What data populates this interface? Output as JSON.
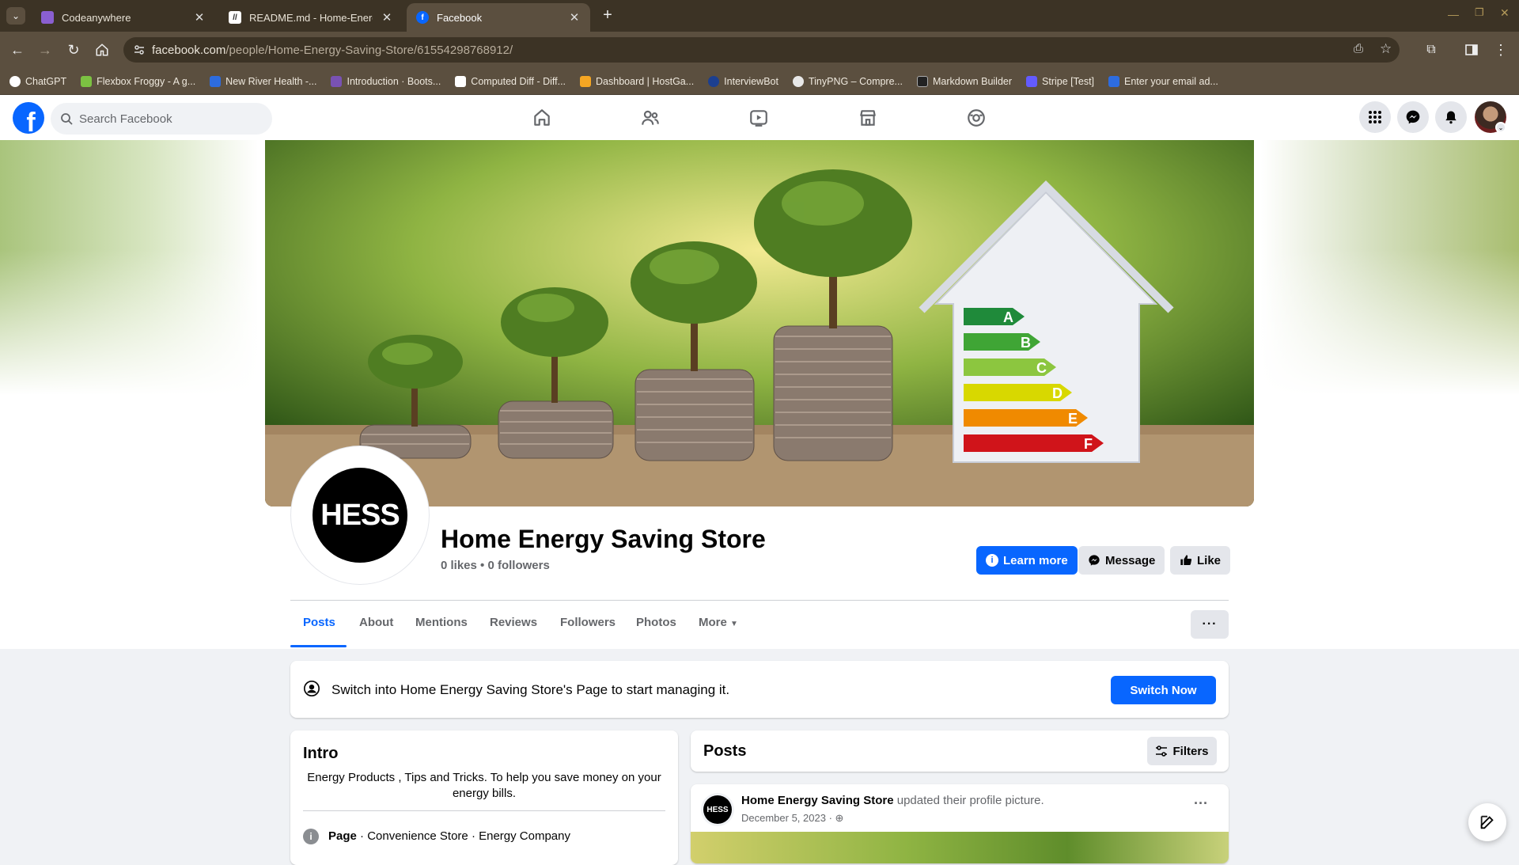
{
  "browser": {
    "tabs": [
      {
        "title": "Codeanywhere",
        "favicon": "codeanywhere-icon",
        "active": false
      },
      {
        "title": "README.md - Home-Energy-Sa",
        "favicon": "readme-icon",
        "active": false
      },
      {
        "title": "Facebook",
        "favicon": "facebook-icon",
        "active": true
      }
    ],
    "new_tab": "+",
    "url_host": "facebook.com",
    "url_path": "/people/Home-Energy-Saving-Store/61554298768912/",
    "bookmarks": [
      {
        "label": "ChatGPT",
        "color": "#ffffff"
      },
      {
        "label": "Flexbox Froggy - A g...",
        "color": "#7cc242"
      },
      {
        "label": "New River Health -...",
        "color": "#2d6cdf"
      },
      {
        "label": "Introduction · Boots...",
        "color": "#7952b3"
      },
      {
        "label": "Computed Diff - Diff...",
        "color": "#ffffff"
      },
      {
        "label": "Dashboard | HostGa...",
        "color": "#f5a623"
      },
      {
        "label": "InterviewBot",
        "color": "#1c3f8f"
      },
      {
        "label": "TinyPNG – Compre...",
        "color": "#e8e8e8"
      },
      {
        "label": "Markdown Builder",
        "color": "#222222"
      },
      {
        "label": "Stripe [Test]",
        "color": "#635bff"
      },
      {
        "label": "Enter your email ad...",
        "color": "#2d6cdf"
      }
    ]
  },
  "fb": {
    "search_placeholder": "Search Facebook",
    "page_name": "Home Energy Saving Store",
    "stats": "0 likes • 0 followers",
    "avatar_text": "HESS",
    "cover_labels": [
      "A",
      "B",
      "C",
      "D",
      "E",
      "F"
    ],
    "buttons": {
      "learn_more": "Learn more",
      "message": "Message",
      "like": "Like"
    },
    "tabs": [
      "Posts",
      "About",
      "Mentions",
      "Reviews",
      "Followers",
      "Photos",
      "More"
    ],
    "switch_banner": {
      "text": "Switch into Home Energy Saving Store's Page to start managing it.",
      "button": "Switch Now"
    },
    "intro": {
      "title": "Intro",
      "bio": "Energy Products , Tips and Tricks. To help you save money on your energy bills.",
      "category_bold": "Page",
      "category_rest": " · Convenience Store · Energy Company"
    },
    "posts": {
      "title": "Posts",
      "filters": "Filters",
      "post_author": "Home Energy Saving Store",
      "post_action": " updated their profile picture.",
      "post_date": "December 5, 2023 · ",
      "post_avatar_text": "HESS"
    }
  },
  "colors": {
    "fb_blue": "#0866ff",
    "chrome_bg": "#3c3325",
    "chrome_toolbar": "#5b4f3f"
  }
}
